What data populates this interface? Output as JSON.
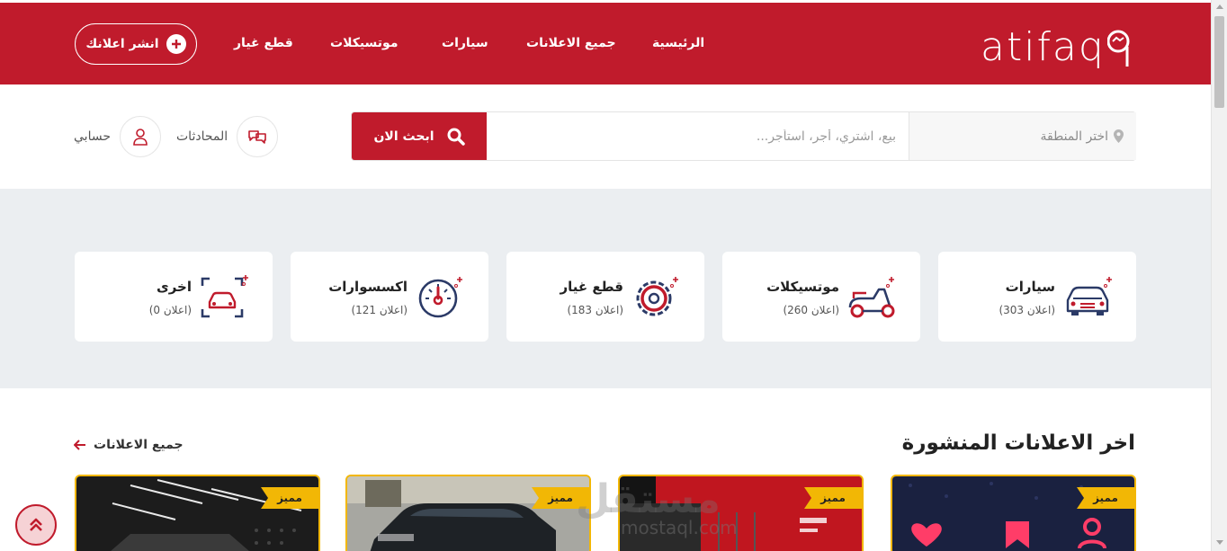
{
  "brand": {
    "logo_text": "atifaq",
    "accent": "#c01b2c",
    "gold": "#f2b705"
  },
  "nav": {
    "items": [
      {
        "label": "الرئيسية"
      },
      {
        "label": "جميع الاعلانات"
      },
      {
        "label": "سيارات"
      },
      {
        "label": "موتسيكلات"
      },
      {
        "label": "قطع غيار"
      }
    ],
    "post_button": "انشر اعلانك"
  },
  "search": {
    "region_label": "اختر المنطقة",
    "placeholder": "بيع، اشتري، أجر، استأجر...",
    "button_label": "ابحث الان"
  },
  "user": {
    "chats_label": "المحادثات",
    "account_label": "حسابي"
  },
  "categories": [
    {
      "title": "سيارات",
      "count": "(اعلان 303)",
      "icon": "car-icon"
    },
    {
      "title": "موتسيكلات",
      "count": "(اعلان 260)",
      "icon": "scooter-icon"
    },
    {
      "title": "قطع غيار",
      "count": "(اعلان 183)",
      "icon": "gear-icon"
    },
    {
      "title": "اكسسوارات",
      "count": "(اعلان 121)",
      "icon": "speedometer-icon"
    },
    {
      "title": "اخرى",
      "count": "(اعلان 0)",
      "icon": "car-frame-icon"
    }
  ],
  "latest": {
    "title": "اخر الاعلانات المنشورة",
    "all_link": "جميع الاعلانات"
  },
  "ads": [
    {
      "badge": "مميز"
    },
    {
      "badge": "مميز"
    },
    {
      "badge": "مميز"
    },
    {
      "badge": "مميز"
    }
  ],
  "watermark": {
    "text": "مستقل",
    "url": "mostaql.com"
  }
}
